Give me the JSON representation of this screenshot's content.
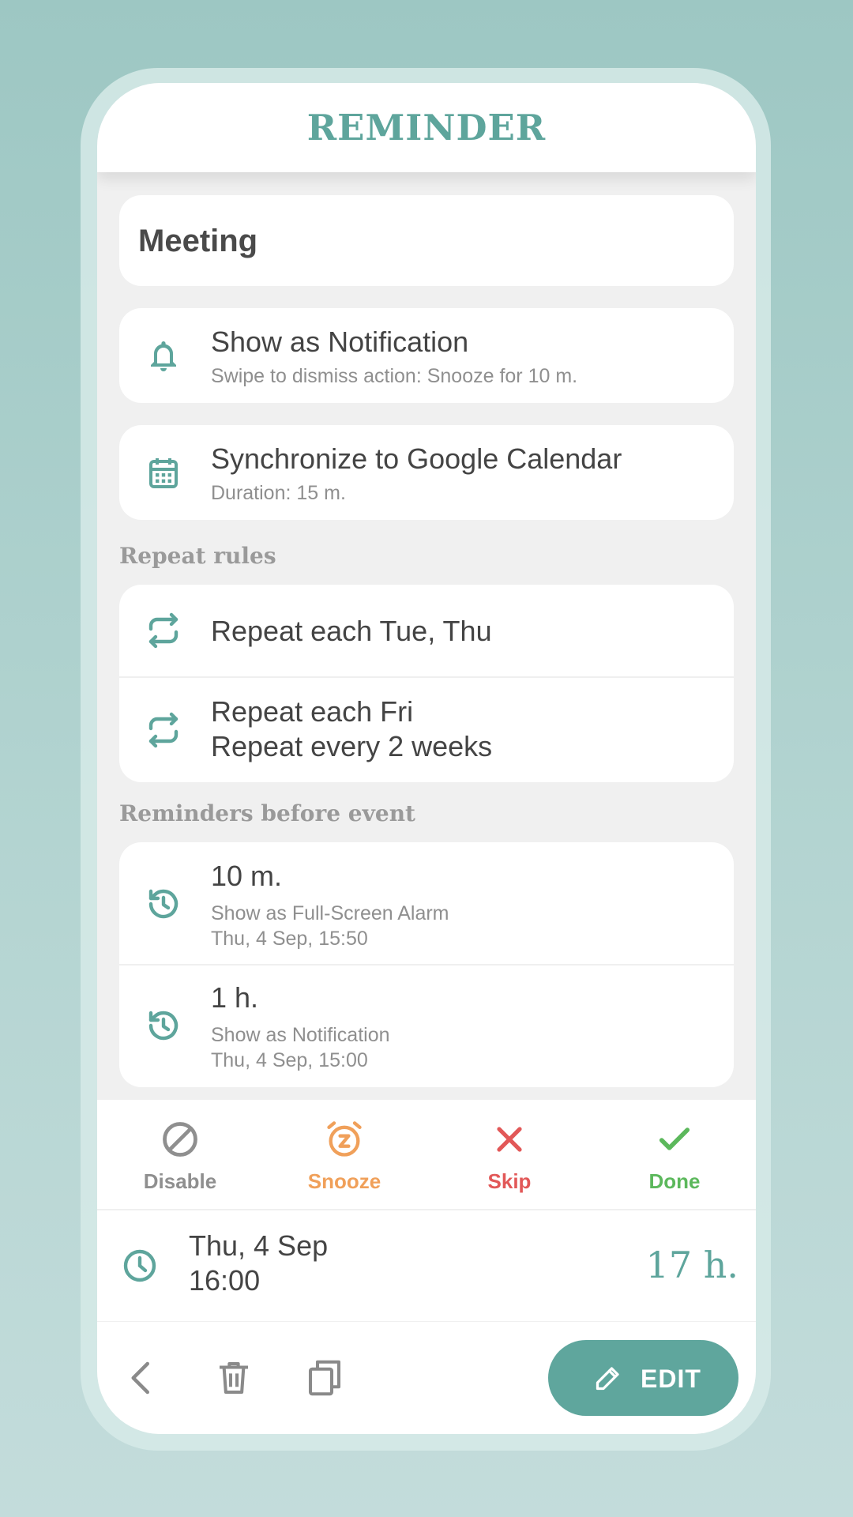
{
  "colors": {
    "accent": "#5ea59c",
    "snooze": "#f0a05a",
    "skip": "#e25858",
    "done": "#5cb85c",
    "disable": "#8f8f8f"
  },
  "header": {
    "title": "REMINDER"
  },
  "reminder": {
    "title": "Meeting"
  },
  "notification": {
    "icon": "bell-icon",
    "title": "Show as Notification",
    "subtitle": "Swipe to dismiss action: Snooze for 10 m."
  },
  "calendar": {
    "icon": "calendar-icon",
    "title": "Synchronize to Google Calendar",
    "subtitle": "Duration: 15 m."
  },
  "repeat_rules": {
    "label": "Repeat rules",
    "items": [
      {
        "icon": "repeat-icon",
        "line1": "Repeat each Tue, Thu"
      },
      {
        "icon": "repeat-icon",
        "line1": "Repeat each Fri",
        "line2": "Repeat every 2 weeks"
      }
    ]
  },
  "reminders_before": {
    "label": "Reminders before event",
    "items": [
      {
        "icon": "history-icon",
        "offset": "10 m.",
        "type": "Show as Full-Screen Alarm",
        "time": "Thu, 4 Sep, 15:50"
      },
      {
        "icon": "history-icon",
        "offset": "1 h.",
        "type": "Show as Notification",
        "time": "Thu, 4 Sep, 15:00"
      }
    ]
  },
  "actions": {
    "disable": "Disable",
    "snooze": "Snooze",
    "skip": "Skip",
    "done": "Done"
  },
  "event": {
    "date": "Thu, 4 Sep",
    "time": "16:00",
    "countdown": "17 h."
  },
  "bottom": {
    "edit_label": "EDIT"
  }
}
